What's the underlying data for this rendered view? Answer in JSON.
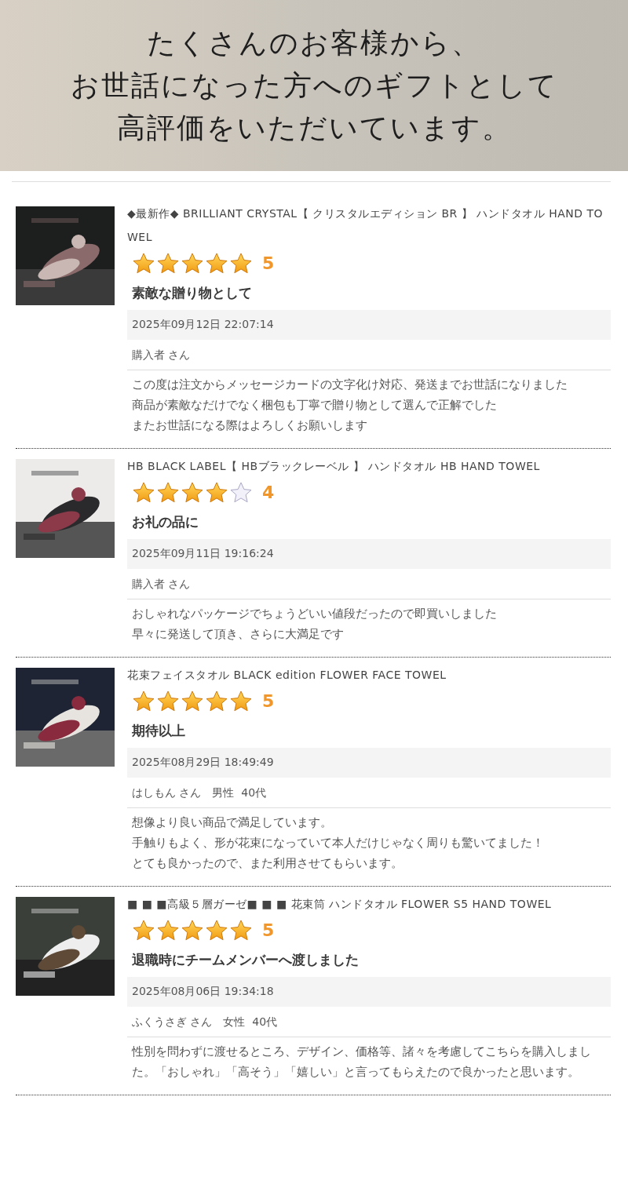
{
  "banner": {
    "lines": [
      "たくさんのお客様から、",
      "お世話になった方へのギフトとして",
      "高評価をいただいています。"
    ]
  },
  "reviews": [
    {
      "image": {
        "kind": "picture"
      },
      "product": "◆最新作◆ BRILLIANT CRYSTAL【 クリスタルエディション BR 】 ハンドタオル HAND TOWEL",
      "stars": 5,
      "rating": "5",
      "headline": "素敵な贈り物として",
      "date": "2025年09月12日 22:07:14",
      "reviewer": "購入者 さん",
      "comment": [
        "この度は注文からメッセージカードの文字化け対応、発送までお世話になりました",
        "商品が素敵なだけでなく梱包も丁寧で贈り物として選んで正解でした",
        "またお世話になる際はよろしくお願いします"
      ]
    },
    {
      "image": {
        "kind": "picture"
      },
      "product": "HB BLACK LABEL【 HBブラックレーベル 】 ハンドタオル HB HAND TOWEL",
      "stars": 4,
      "rating": "4",
      "headline": "お礼の品に",
      "date": "2025年09月11日 19:16:24",
      "reviewer": "購入者 さん",
      "comment": [
        "おしゃれなパッケージでちょうどいい値段だったので即買いしました",
        "早々に発送して頂き、さらに大満足です"
      ]
    },
    {
      "image": {
        "kind": "picture"
      },
      "product": "花束フェイスタオル BLACK edition FLOWER FACE TOWEL",
      "stars": 5,
      "rating": "5",
      "headline": "期待以上",
      "date": "2025年08月29日 18:49:49",
      "reviewer": "はしもん さん　男性  40代",
      "comment": [
        "想像より良い商品で満足しています。",
        "手触りもよく、形が花束になっていて本人だけじゃなく周りも驚いてました！",
        "とても良かったので、また利用させてもらいます。"
      ]
    },
    {
      "image": {
        "kind": "picture"
      },
      "product": "■ ■ ■高級５層ガーゼ■ ■ ■ 花束筒 ハンドタオル FLOWER S5 HAND TOWEL",
      "stars": 5,
      "rating": "5",
      "headline": "退職時にチームメンバーへ渡しました",
      "date": "2025年08月06日 19:34:18",
      "reviewer": "ふくうさぎ さん　女性  40代",
      "comment": [
        "性別を問わずに渡せるところ、デザイン、価格等、諸々を考慮してこちらを購入しました。「おしゃれ」「高そう」「嬉しい」と言ってもらえたので良かったと思います。"
      ]
    }
  ]
}
